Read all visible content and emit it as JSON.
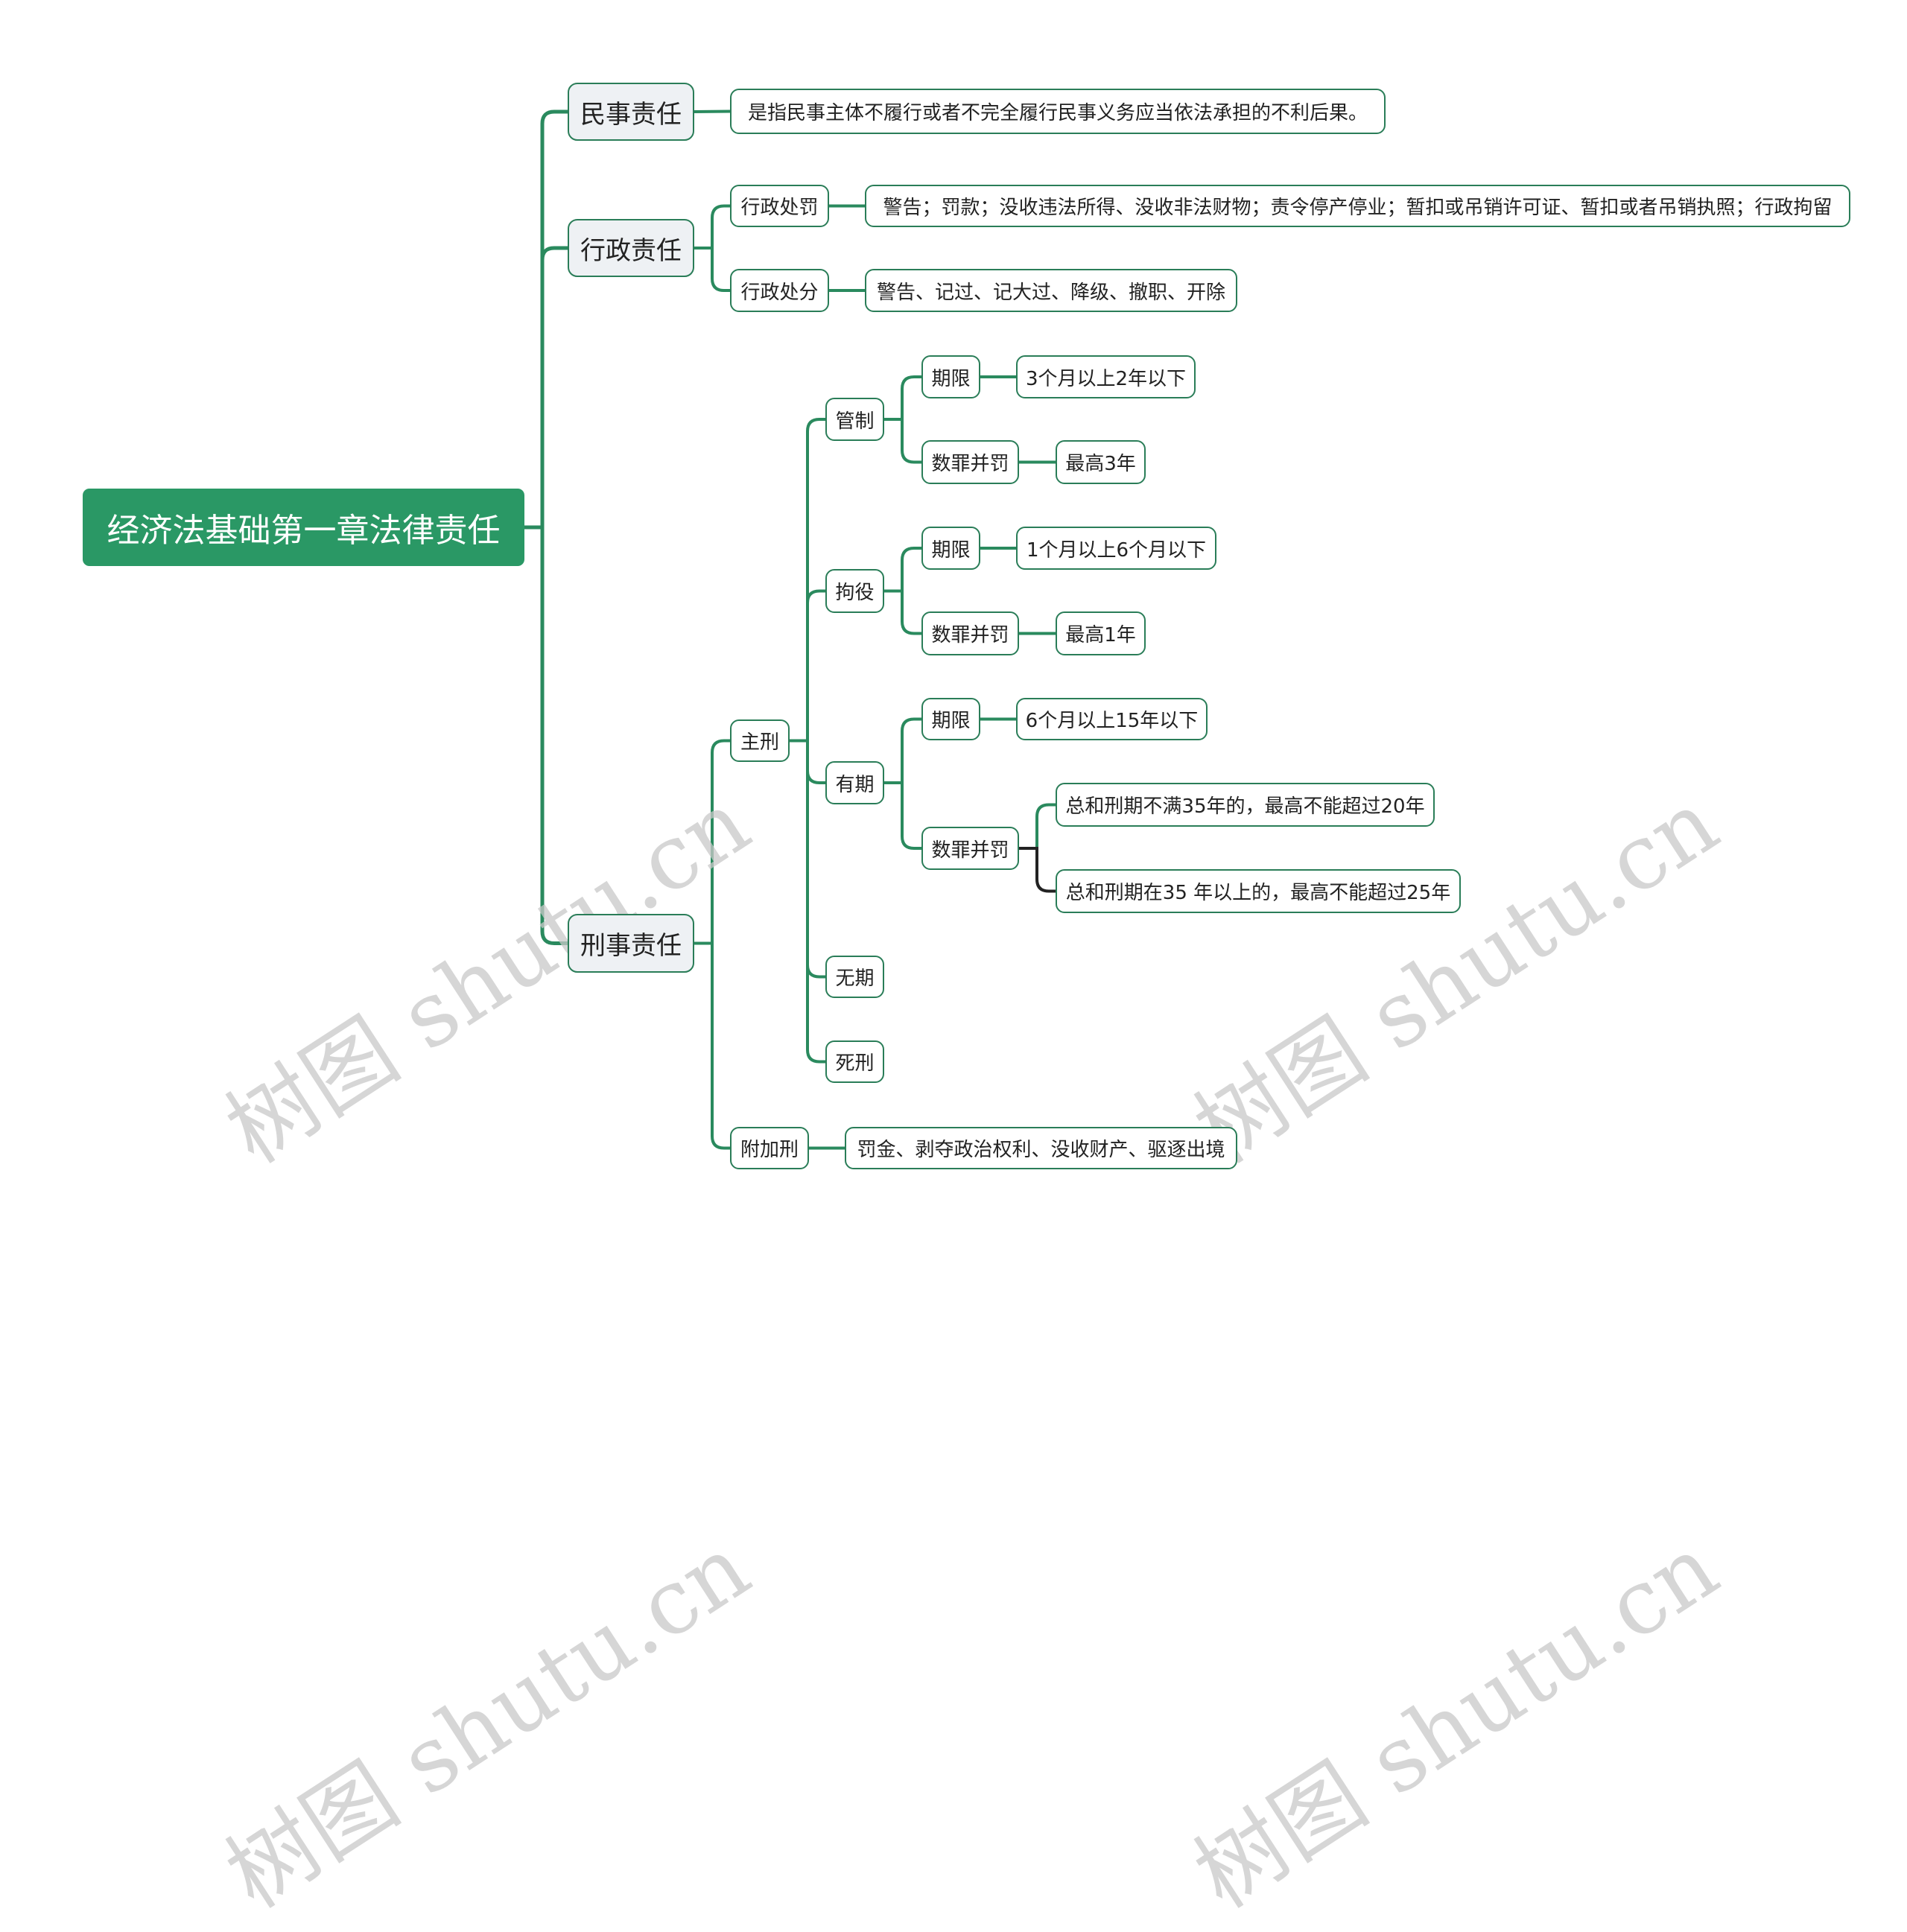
{
  "map": {
    "root": "经济法基础第一章法律责任",
    "civil": {
      "label": "民事责任",
      "desc": "是指民事主体不履行或者不完全履行民事义务应当依法承担的不利后果。"
    },
    "administrative": {
      "label": "行政责任",
      "penalty": {
        "label": "行政处罚",
        "desc": "警告；罚款；没收违法所得、没收非法财物；责令停产停业；暂扣或吊销许可证、暂扣或者吊销执照；行政拘留"
      },
      "sanction": {
        "label": "行政处分",
        "desc": "警告、记过、记大过、降级、撤职、开除"
      }
    },
    "criminal": {
      "label": "刑事责任",
      "principal": {
        "label": "主刑",
        "control": {
          "label": "管制",
          "term_label": "期限",
          "term": "3个月以上2年以下",
          "combined_label": "数罪并罚",
          "combined": "最高3年"
        },
        "detention": {
          "label": "拘役",
          "term_label": "期限",
          "term": "1个月以上6个月以下",
          "combined_label": "数罪并罚",
          "combined": "最高1年"
        },
        "fixed_term": {
          "label": "有期",
          "term_label": "期限",
          "term": "6个月以上15年以下",
          "combined_label": "数罪并罚",
          "combined_items": [
            "总和刑期不满35年的，最高不能超过20年",
            "总和刑期在35 年以上的，最高不能超过25年"
          ]
        },
        "life": {
          "label": "无期"
        },
        "death": {
          "label": "死刑"
        }
      },
      "supplementary": {
        "label": "附加刑",
        "desc": "罚金、剥夺政治权利、没收财产、驱逐出境"
      }
    }
  },
  "watermark": "树图 shutu.cn",
  "colors": {
    "accent": "#2a9865",
    "line": "#2a8a5e",
    "line_dark": "#222222",
    "node_border": "#2a7d58",
    "l1_fill": "#eef1f4"
  }
}
